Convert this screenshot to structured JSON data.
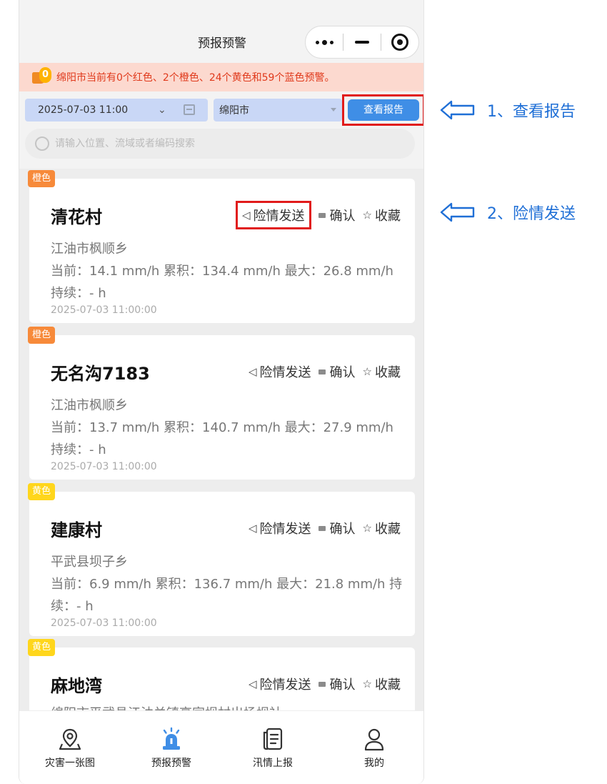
{
  "nav": {
    "title": "预报预警"
  },
  "banner": {
    "badge": "0",
    "text": "绵阳市当前有0个红色、2个橙色、24个黄色和59个蓝色预警。"
  },
  "filters": {
    "date": "2025-07-03 11:00",
    "city": "绵阳市",
    "report_button": "查看报告"
  },
  "search": {
    "placeholder": "请输入位置、流域或者编码搜索"
  },
  "actions": {
    "send": "险情发送",
    "confirm": "确认",
    "favorite": "收藏"
  },
  "cards": [
    {
      "level": "橙色",
      "level_color": "#f78a3a",
      "name": "清花村",
      "region": "江油市枫顺乡",
      "metrics": "当前：14.1 mm/h 累积：134.4 mm/h 最大：26.8 mm/h",
      "duration": "持续：- h",
      "time": "2025-07-03 11:00:00"
    },
    {
      "level": "橙色",
      "level_color": "#f78a3a",
      "name": "无名沟7183",
      "region": "江油市枫顺乡",
      "metrics": "当前：13.7 mm/h 累积：140.7 mm/h 最大：27.9 mm/h",
      "duration": "持续：- h",
      "time": "2025-07-03 11:00:00"
    },
    {
      "level": "黄色",
      "level_color": "#ffd61c",
      "name": "建康村",
      "region": "平武县坝子乡",
      "metrics": "当前：6.9 mm/h 累积：136.7 mm/h 最大：21.8 mm/h 持续：- h",
      "time": "2025-07-03 11:00:00"
    },
    {
      "level": "黄色",
      "level_color": "#ffd61c",
      "name": "麻地湾",
      "region": "绵阳市平武县江油关镇高家坝村出场坝社"
    }
  ],
  "tabs": [
    {
      "label": "灾害一张图",
      "icon": "map-pin-icon"
    },
    {
      "label": "预报预警",
      "icon": "alarm-light-icon"
    },
    {
      "label": "汛情上报",
      "icon": "report-doc-icon"
    },
    {
      "label": "我的",
      "icon": "user-icon"
    }
  ],
  "annotations": [
    {
      "text": "1、查看报告"
    },
    {
      "text": "2、险情发送"
    }
  ],
  "colors": {
    "accent": "#3f8ee6",
    "highlight_box": "#e11b1b",
    "banner_bg": "#fcd9cf",
    "banner_text": "#e03a1c",
    "annotation": "#1f6fd6"
  }
}
